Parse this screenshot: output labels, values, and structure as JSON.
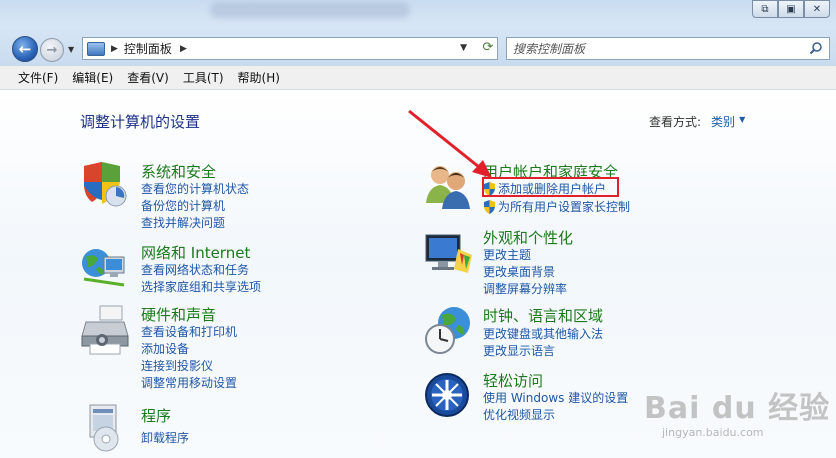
{
  "window": {
    "restore_btn": "⧉",
    "max_btn": "▣",
    "close_btn": "✕"
  },
  "nav": {
    "breadcrumb": "控制面板",
    "search_placeholder": "搜索控制面板"
  },
  "menu": [
    "文件(F)",
    "编辑(E)",
    "查看(V)",
    "工具(T)",
    "帮助(H)"
  ],
  "main": {
    "heading": "调整计算机的设置",
    "view_by_label": "查看方式:",
    "view_by_value": "类别"
  },
  "categories": [
    {
      "title": "系统和安全",
      "icon": "shield-icon",
      "links": [
        "查看您的计算机状态",
        "备份您的计算机",
        "查找并解决问题"
      ]
    },
    {
      "title": "网络和 Internet",
      "icon": "network-icon",
      "links": [
        "查看网络状态和任务",
        "选择家庭组和共享选项"
      ]
    },
    {
      "title": "硬件和声音",
      "icon": "printer-icon",
      "links": [
        "查看设备和打印机",
        "添加设备",
        "连接到投影仪",
        "调整常用移动设置"
      ]
    },
    {
      "title": "程序",
      "icon": "programs-icon",
      "links": [
        "卸载程序"
      ]
    },
    {
      "title": "用户帐户和家庭安全",
      "icon": "users-icon",
      "links": [
        "添加或删除用户帐户",
        "为所有用户设置家长控制"
      ]
    },
    {
      "title": "外观和个性化",
      "icon": "display-icon",
      "links": [
        "更改主题",
        "更改桌面背景",
        "调整屏幕分辨率"
      ]
    },
    {
      "title": "时钟、语言和区域",
      "icon": "clock-globe-icon",
      "links": [
        "更改键盘或其他输入法",
        "更改显示语言"
      ]
    },
    {
      "title": "轻松访问",
      "icon": "ease-of-access-icon",
      "links": [
        "使用 Windows 建议的设置",
        "优化视频显示"
      ]
    }
  ],
  "watermark": {
    "logo_text": "Bai du 经验",
    "url": "jingyan.baidu.com"
  },
  "colors": {
    "category_title": "#1b7a1b",
    "link": "#1f57a8",
    "heading": "#1e3287",
    "highlight": "#e2202b"
  }
}
